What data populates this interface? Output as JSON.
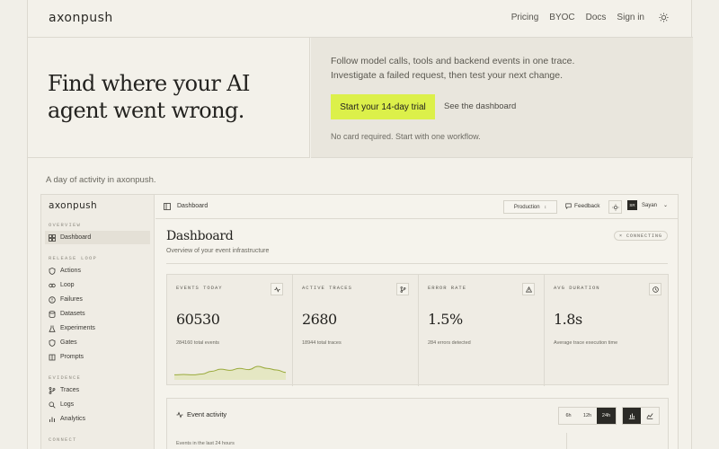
{
  "brand": "axonpush",
  "nav": {
    "links": [
      "Pricing",
      "BYOC",
      "Docs",
      "Sign in"
    ],
    "theme_icon": "sun-icon"
  },
  "hero": {
    "title": "Find where your AI agent went wrong.",
    "description": "Follow model calls, tools and backend events in one trace. Investigate a failed request, then test your next change.",
    "cta": "Start your 14-day trial",
    "secondary": "See the dashboard",
    "note": "No card required. Start with one workflow."
  },
  "caption": "A day of activity in axonpush.",
  "app": {
    "logo": "axonpush",
    "sidebar": {
      "overview_label": "OVERVIEW",
      "overview": [
        "Dashboard"
      ],
      "release_label": "RELEASE LOOP",
      "release": [
        "Actions",
        "Loop",
        "Failures",
        "Datasets",
        "Experiments",
        "Gates",
        "Prompts"
      ],
      "evidence_label": "EVIDENCE",
      "evidence": [
        "Traces",
        "Logs",
        "Analytics"
      ],
      "connect_label": "CONNECT"
    },
    "topbar": {
      "breadcrumb": "Dashboard",
      "environment": "Production",
      "feedback": "Feedback",
      "user_initials": "SR",
      "user_name": "Sayan"
    },
    "dashboard": {
      "title": "Dashboard",
      "subtitle": "Overview of your event infrastructure",
      "status": "CONNECTING",
      "stats": [
        {
          "label": "EVENTS TODAY",
          "value": "60530",
          "desc": "284160 total events",
          "icon": "activity-icon"
        },
        {
          "label": "ACTIVE TRACES",
          "value": "2680",
          "desc": "18944 total traces",
          "icon": "branch-icon"
        },
        {
          "label": "ERROR RATE",
          "value": "1.5%",
          "desc": "284 errors detected",
          "icon": "warning-icon"
        },
        {
          "label": "AVG DURATION",
          "value": "1.8s",
          "desc": "Average trace execution time",
          "icon": "clock-icon"
        }
      ],
      "sparkline": [
        0.2,
        0.22,
        0.2,
        0.25,
        0.42,
        0.55,
        0.48,
        0.6,
        0.52,
        0.72,
        0.6,
        0.5,
        0.35
      ],
      "activity": {
        "title": "Event activity",
        "ranges": [
          "6h",
          "12h",
          "24h"
        ],
        "selected_range": "24h",
        "views": [
          "bar-chart-icon",
          "area-chart-icon"
        ],
        "subtitle": "Events in the last 24 hours"
      }
    }
  },
  "colors": {
    "accent": "#dcf04a",
    "spark": "#9aaa3c"
  }
}
